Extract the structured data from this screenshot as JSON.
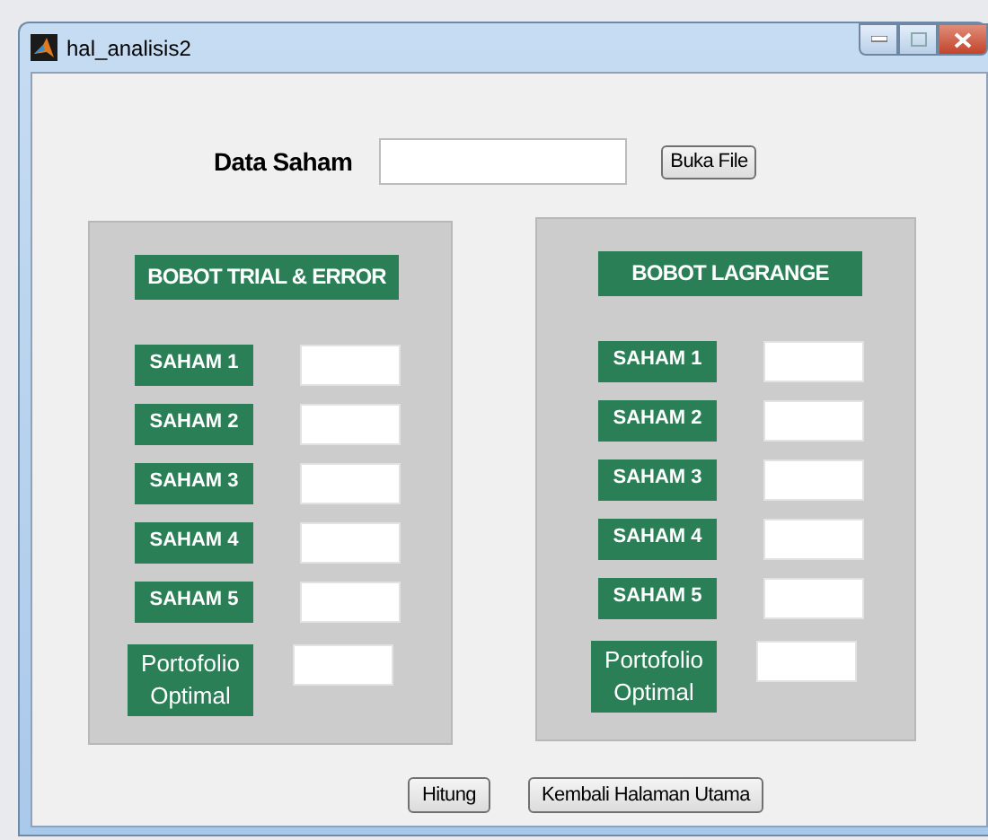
{
  "window": {
    "title": "hal_analisis2"
  },
  "data_saham": {
    "label": "Data Saham",
    "button": "Buka File"
  },
  "panels": [
    {
      "title": "BOBOT TRIAL & ERROR",
      "rows": [
        {
          "label": "SAHAM 1"
        },
        {
          "label": "SAHAM 2"
        },
        {
          "label": "SAHAM 3"
        },
        {
          "label": "SAHAM 4"
        },
        {
          "label": "SAHAM 5"
        },
        {
          "label": "Portofolio Optimal"
        }
      ]
    },
    {
      "title": "BOBOT LAGRANGE",
      "rows": [
        {
          "label": "SAHAM 1"
        },
        {
          "label": "SAHAM 2"
        },
        {
          "label": "SAHAM 3"
        },
        {
          "label": "SAHAM 4"
        },
        {
          "label": "SAHAM 5"
        },
        {
          "label": "Portofolio Optimal"
        }
      ]
    }
  ],
  "buttons": [
    "Hitung",
    "Kembali Halaman Utama"
  ]
}
